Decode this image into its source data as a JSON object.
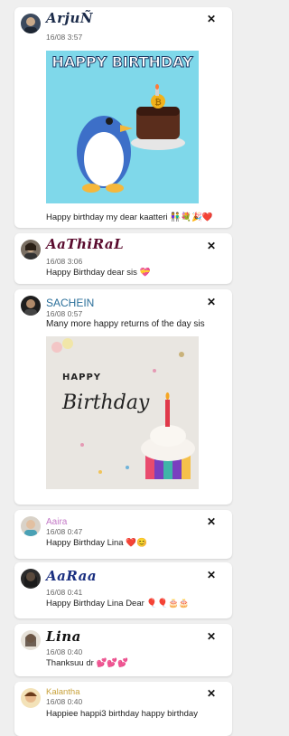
{
  "posts": [
    {
      "author": "ArjuÑ",
      "author_color": "#1b2b4a",
      "time": "16/08 3:57",
      "message": "Happy birthday my dear kaatteri 👫💐🎉❤️",
      "image": {
        "banner_text": "HAPPY BIRTHDAY",
        "bg": "#7fd8ea"
      }
    },
    {
      "author": "AaThiRaL",
      "author_color": "#5a0b2e",
      "time": "16/08 3:06",
      "message": "Happy Birthday dear sis 💝"
    },
    {
      "author": "SACHEIN",
      "author_color": "#2a6f9a",
      "time": "16/08 0:57",
      "message": "Many more happy returns of the day sis",
      "image": {
        "line1": "HAPPY",
        "line2": "Birthday",
        "bg": "#e9e6e1"
      }
    },
    {
      "author": "Aaira",
      "author_color": "#c47ac7",
      "time": "16/08 0:47",
      "message": "Happy Birthday Lina ❤️😊"
    },
    {
      "author": "AaRaa",
      "author_color": "#1a2f80",
      "time": "16/08 0:41",
      "message": "Happy Birthday Lina Dear 🎈🎈🎂🎂"
    },
    {
      "author": "Lina",
      "author_color": "#111111",
      "time": "16/08 0:40",
      "message": "Thanksuu dr 💕💕💕"
    },
    {
      "author": "Kalantha",
      "author_color": "#c9a23b",
      "time": "16/08 0:40",
      "message": "Happiee happi3 birthday happy birthday"
    }
  ],
  "close_glyph": "✕"
}
